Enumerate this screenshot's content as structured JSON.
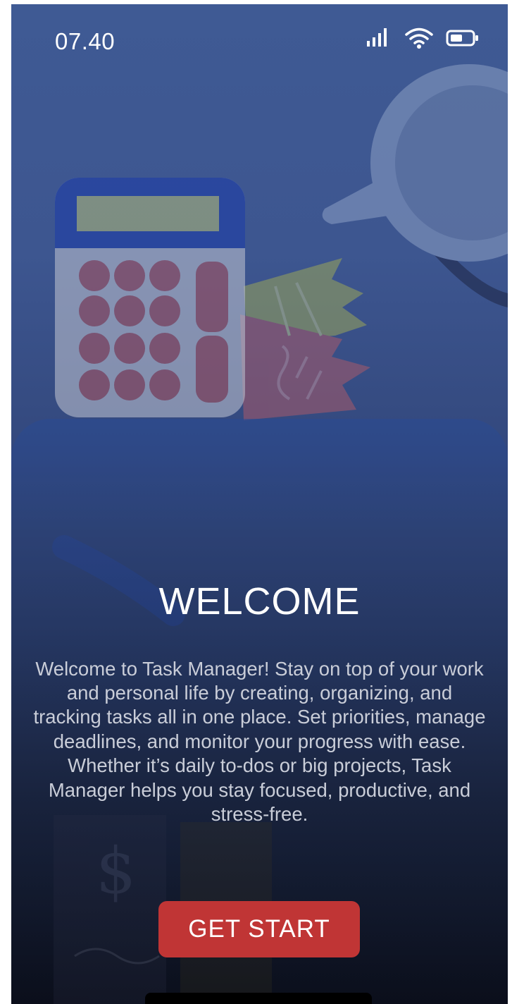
{
  "status_bar": {
    "time": "07.40",
    "icons": [
      "signal-icon",
      "wifi-icon",
      "battery-icon"
    ]
  },
  "welcome": {
    "title": "WELCOME",
    "description": "Welcome to Task Manager! Stay on top of your work and personal life by creating, organizing, and tracking tasks all in one place. Set priorities, manage deadlines, and monitor your progress with ease. Whether it’s daily to-dos or big projects, Task Manager helps you stay focused, productive, and stress-free.",
    "button_label": "GET START"
  },
  "colors": {
    "background_top": "#3f5a94",
    "background_bottom": "#0b0f1c",
    "button": "#c03535",
    "title_text": "#ffffff",
    "body_text": "#c9cdd8"
  }
}
